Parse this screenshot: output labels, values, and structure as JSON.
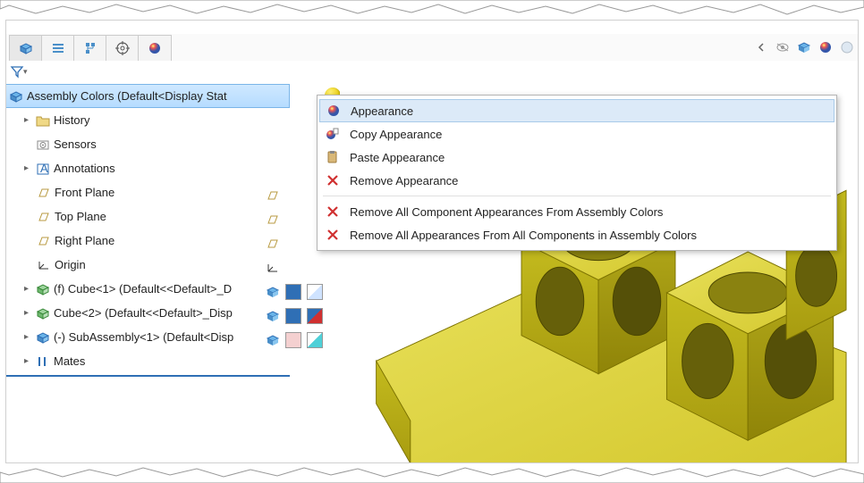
{
  "tree": {
    "root": "Assembly Colors  (Default<Display Stat",
    "history": "History",
    "sensors": "Sensors",
    "annotations": "Annotations",
    "front_plane": "Front Plane",
    "top_plane": "Top Plane",
    "right_plane": "Right Plane",
    "origin": "Origin",
    "cube1": "(f) Cube<1> (Default<<Default>_D",
    "cube2": "Cube<2> (Default<<Default>_Disp",
    "subasm": "(-) SubAssembly<1> (Default<Disp",
    "mates": "Mates"
  },
  "menu": {
    "appearance": "Appearance",
    "copy": "Copy Appearance",
    "paste": "Paste Appearance",
    "remove": "Remove Appearance",
    "remove_all_comp": "Remove All Component Appearances From Assembly Colors",
    "remove_all_all": "Remove All Appearances From All Components in Assembly Colors"
  }
}
